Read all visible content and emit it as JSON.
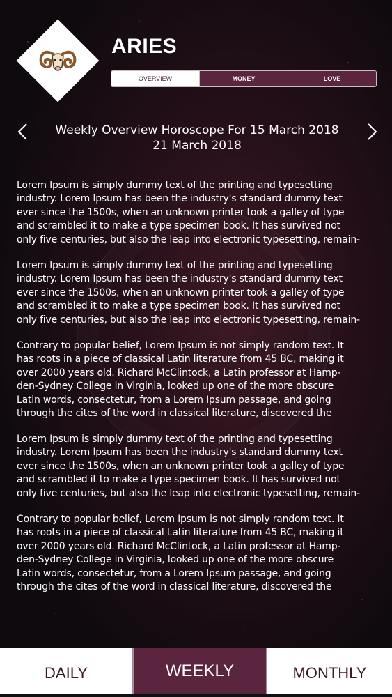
{
  "header": {
    "sign_name": "ARIES",
    "logo_icon": "ram-icon",
    "tabs": [
      {
        "label": "OVERVIEW",
        "active": true
      },
      {
        "label": "MONEY",
        "active": false
      },
      {
        "label": "LOVE",
        "active": false
      }
    ]
  },
  "week_nav": {
    "title_line1": "Weekly Overview Horoscope For 15 March 2018",
    "title_line2": "21 March 2018",
    "prev_icon": "chevron-left-icon",
    "next_icon": "chevron-right-icon"
  },
  "content": {
    "paragraphs": [
      "Lorem Ipsum is simply dummy text of the printing and typesetting\nindustry. Lorem Ipsum has been the industry's standard dummy text\never since the 1500s, when an unknown printer took a galley of type\nand scrambled it to make a type specimen book. It has survived not\nonly five centuries, but also the leap into electronic typesetting, remain-",
      "Lorem Ipsum is simply dummy text of the printing and typesetting\nindustry. Lorem Ipsum has been the industry's standard dummy text\never since the 1500s, when an unknown printer took a galley of type\nand scrambled it to make a type specimen book. It has survived not\nonly five centuries, but also the leap into electronic typesetting, remain-",
      "Contrary to popular belief, Lorem Ipsum is not simply random text. It\nhas roots in a piece of classical Latin literature from 45 BC, making it\nover 2000 years old. Richard McClintock, a Latin professor at Hamp-\nden-Sydney College in Virginia, looked up one of the more obscure\nLatin words, consectetur, from a Lorem Ipsum passage, and going\nthrough the cites of the word in classical literature, discovered the",
      "Lorem Ipsum is simply dummy text of the printing and typesetting\nindustry. Lorem Ipsum has been the industry's standard dummy text\never since the 1500s, when an unknown printer took a galley of type\nand scrambled it to make a type specimen book. It has survived not\nonly five centuries, but also the leap into electronic typesetting, remain-",
      "Contrary to popular belief, Lorem Ipsum is not simply random text. It\nhas roots in a piece of classical Latin literature from 45 BC, making it\nover 2000 years old. Richard McClintock, a Latin professor at Hamp-\nden-Sydney College in Virginia, looked up one of the more obscure\nLatin words, consectetur, from a Lorem Ipsum passage, and going\nthrough the cites of the word in classical literature, discovered the"
    ]
  },
  "bottom_nav": {
    "items": [
      {
        "label": "DAILY",
        "active": false
      },
      {
        "label": "WEEKLY",
        "active": true
      },
      {
        "label": "MONTHLY",
        "active": false
      }
    ]
  },
  "colors": {
    "accent": "#5b2540",
    "background": "#0c0a0c",
    "text": "#ffffff"
  }
}
